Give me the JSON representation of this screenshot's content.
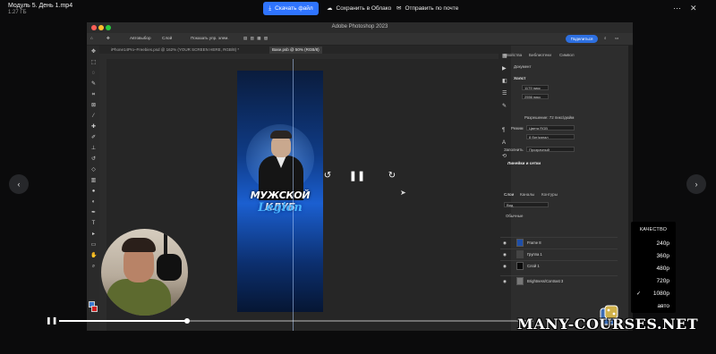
{
  "header": {
    "file_name": "Модуль 5. День 1.mp4",
    "file_size": "1.27 ГБ",
    "download_label": "Скачать файл",
    "cloud_label": "Сохранить в Облако",
    "email_label": "Отправить по почте"
  },
  "photoshop": {
    "title": "Adobe Photoshop 2023",
    "options": {
      "autoselect": "Автовыбор",
      "layer": "Слой",
      "show_controls": "Показать упр. элем.",
      "share": "Поделиться"
    },
    "tabs": [
      {
        "label": "iPhone14Pro–Freebies.psd @ 162% (YOUR SCREEN HERE, RGB/8) *"
      },
      {
        "label": "Base.psb @ 50% (RGB/8)"
      }
    ],
    "artwork": {
      "line1": "МУЖСКОЙ КЛУБ",
      "line2": "Legion"
    },
    "properties": {
      "tabs": [
        "Свойства",
        "Библиотеки",
        "Символ"
      ],
      "section_doc": "Документ",
      "section_canvas": "Холст",
      "width": "1179 пикс",
      "height": "2556 пикс",
      "resolution": "Разрешение: 72 пикс/дюйм",
      "mode_label": "Режим",
      "mode_value": "Цвета RGB",
      "bits": "8 бит/канал",
      "fill_label": "Заполнить",
      "fill_value": "Прозрачный",
      "rulers": "Линейки и сетки"
    },
    "layers": {
      "tabs": [
        "Слои",
        "Каналы",
        "Контуры"
      ],
      "kind": "Вид",
      "normal": "Обычные",
      "items": [
        {
          "name": "Frame 8"
        },
        {
          "name": "Группа 1"
        },
        {
          "name": "Слой 1"
        },
        {
          "name": "Brightness/Contrast 3"
        }
      ]
    }
  },
  "player": {
    "progress": 0.27
  },
  "quality": {
    "title": "КАЧЕСТВО",
    "options": [
      "240p",
      "360p",
      "480p",
      "720p",
      "1080p",
      "авто"
    ],
    "selected": "1080p"
  },
  "watermark": "MANY-COURSES.NET"
}
